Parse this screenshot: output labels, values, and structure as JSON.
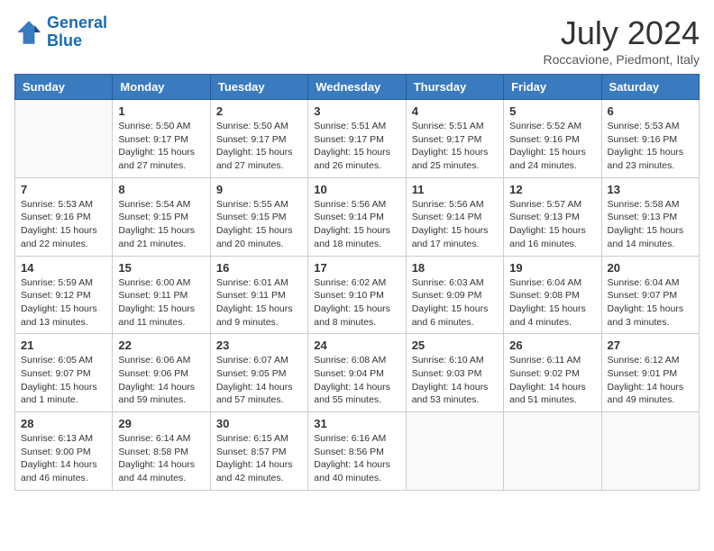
{
  "header": {
    "logo_line1": "General",
    "logo_line2": "Blue",
    "month_year": "July 2024",
    "location": "Roccavione, Piedmont, Italy"
  },
  "days_of_week": [
    "Sunday",
    "Monday",
    "Tuesday",
    "Wednesday",
    "Thursday",
    "Friday",
    "Saturday"
  ],
  "weeks": [
    [
      {
        "day": "",
        "info": ""
      },
      {
        "day": "1",
        "info": "Sunrise: 5:50 AM\nSunset: 9:17 PM\nDaylight: 15 hours\nand 27 minutes."
      },
      {
        "day": "2",
        "info": "Sunrise: 5:50 AM\nSunset: 9:17 PM\nDaylight: 15 hours\nand 27 minutes."
      },
      {
        "day": "3",
        "info": "Sunrise: 5:51 AM\nSunset: 9:17 PM\nDaylight: 15 hours\nand 26 minutes."
      },
      {
        "day": "4",
        "info": "Sunrise: 5:51 AM\nSunset: 9:17 PM\nDaylight: 15 hours\nand 25 minutes."
      },
      {
        "day": "5",
        "info": "Sunrise: 5:52 AM\nSunset: 9:16 PM\nDaylight: 15 hours\nand 24 minutes."
      },
      {
        "day": "6",
        "info": "Sunrise: 5:53 AM\nSunset: 9:16 PM\nDaylight: 15 hours\nand 23 minutes."
      }
    ],
    [
      {
        "day": "7",
        "info": "Sunrise: 5:53 AM\nSunset: 9:16 PM\nDaylight: 15 hours\nand 22 minutes."
      },
      {
        "day": "8",
        "info": "Sunrise: 5:54 AM\nSunset: 9:15 PM\nDaylight: 15 hours\nand 21 minutes."
      },
      {
        "day": "9",
        "info": "Sunrise: 5:55 AM\nSunset: 9:15 PM\nDaylight: 15 hours\nand 20 minutes."
      },
      {
        "day": "10",
        "info": "Sunrise: 5:56 AM\nSunset: 9:14 PM\nDaylight: 15 hours\nand 18 minutes."
      },
      {
        "day": "11",
        "info": "Sunrise: 5:56 AM\nSunset: 9:14 PM\nDaylight: 15 hours\nand 17 minutes."
      },
      {
        "day": "12",
        "info": "Sunrise: 5:57 AM\nSunset: 9:13 PM\nDaylight: 15 hours\nand 16 minutes."
      },
      {
        "day": "13",
        "info": "Sunrise: 5:58 AM\nSunset: 9:13 PM\nDaylight: 15 hours\nand 14 minutes."
      }
    ],
    [
      {
        "day": "14",
        "info": "Sunrise: 5:59 AM\nSunset: 9:12 PM\nDaylight: 15 hours\nand 13 minutes."
      },
      {
        "day": "15",
        "info": "Sunrise: 6:00 AM\nSunset: 9:11 PM\nDaylight: 15 hours\nand 11 minutes."
      },
      {
        "day": "16",
        "info": "Sunrise: 6:01 AM\nSunset: 9:11 PM\nDaylight: 15 hours\nand 9 minutes."
      },
      {
        "day": "17",
        "info": "Sunrise: 6:02 AM\nSunset: 9:10 PM\nDaylight: 15 hours\nand 8 minutes."
      },
      {
        "day": "18",
        "info": "Sunrise: 6:03 AM\nSunset: 9:09 PM\nDaylight: 15 hours\nand 6 minutes."
      },
      {
        "day": "19",
        "info": "Sunrise: 6:04 AM\nSunset: 9:08 PM\nDaylight: 15 hours\nand 4 minutes."
      },
      {
        "day": "20",
        "info": "Sunrise: 6:04 AM\nSunset: 9:07 PM\nDaylight: 15 hours\nand 3 minutes."
      }
    ],
    [
      {
        "day": "21",
        "info": "Sunrise: 6:05 AM\nSunset: 9:07 PM\nDaylight: 15 hours\nand 1 minute."
      },
      {
        "day": "22",
        "info": "Sunrise: 6:06 AM\nSunset: 9:06 PM\nDaylight: 14 hours\nand 59 minutes."
      },
      {
        "day": "23",
        "info": "Sunrise: 6:07 AM\nSunset: 9:05 PM\nDaylight: 14 hours\nand 57 minutes."
      },
      {
        "day": "24",
        "info": "Sunrise: 6:08 AM\nSunset: 9:04 PM\nDaylight: 14 hours\nand 55 minutes."
      },
      {
        "day": "25",
        "info": "Sunrise: 6:10 AM\nSunset: 9:03 PM\nDaylight: 14 hours\nand 53 minutes."
      },
      {
        "day": "26",
        "info": "Sunrise: 6:11 AM\nSunset: 9:02 PM\nDaylight: 14 hours\nand 51 minutes."
      },
      {
        "day": "27",
        "info": "Sunrise: 6:12 AM\nSunset: 9:01 PM\nDaylight: 14 hours\nand 49 minutes."
      }
    ],
    [
      {
        "day": "28",
        "info": "Sunrise: 6:13 AM\nSunset: 9:00 PM\nDaylight: 14 hours\nand 46 minutes."
      },
      {
        "day": "29",
        "info": "Sunrise: 6:14 AM\nSunset: 8:58 PM\nDaylight: 14 hours\nand 44 minutes."
      },
      {
        "day": "30",
        "info": "Sunrise: 6:15 AM\nSunset: 8:57 PM\nDaylight: 14 hours\nand 42 minutes."
      },
      {
        "day": "31",
        "info": "Sunrise: 6:16 AM\nSunset: 8:56 PM\nDaylight: 14 hours\nand 40 minutes."
      },
      {
        "day": "",
        "info": ""
      },
      {
        "day": "",
        "info": ""
      },
      {
        "day": "",
        "info": ""
      }
    ]
  ]
}
